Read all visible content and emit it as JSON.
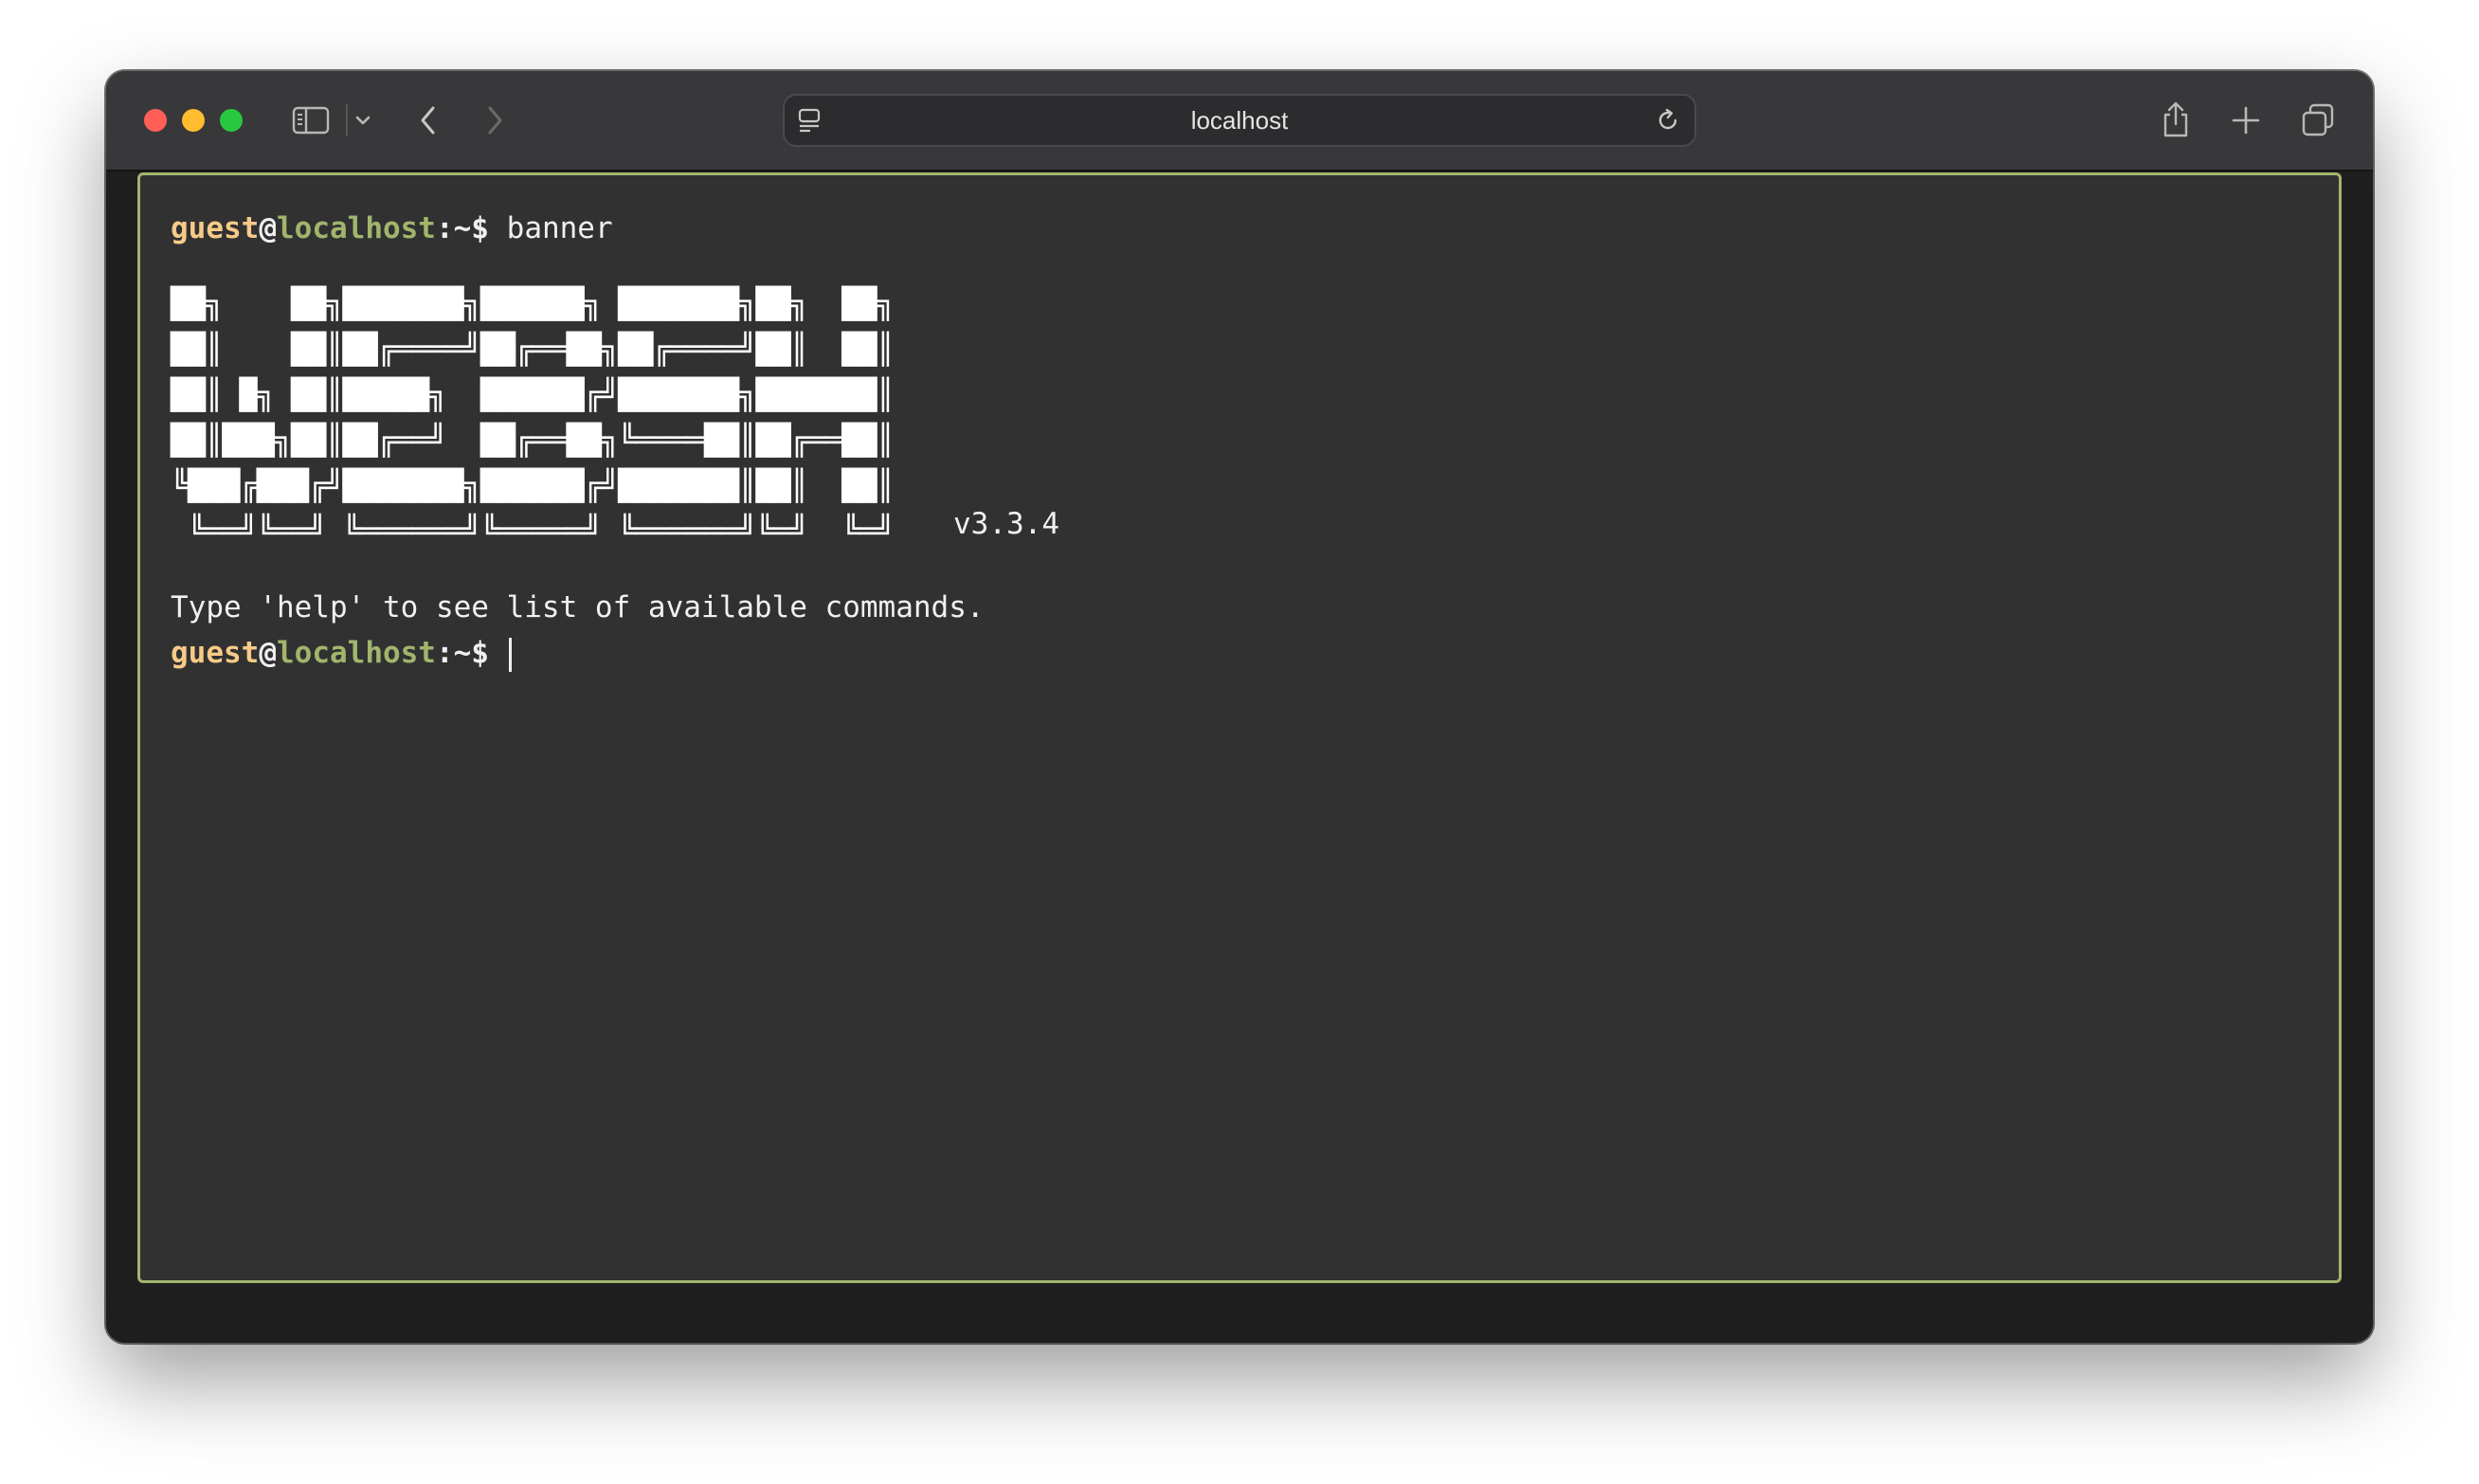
{
  "browser": {
    "address": "localhost",
    "icons": {
      "sidebar": "sidebar-icon",
      "sidebar_menu": "chevron-down-icon",
      "back": "back-icon",
      "forward": "forward-icon",
      "site_settings": "page-settings-icon",
      "reload": "reload-icon",
      "share": "share-icon",
      "new_tab": "plus-icon",
      "tabs": "tab-overview-icon"
    }
  },
  "terminal": {
    "accent_color": "#a1b56c",
    "prompt": {
      "user": "guest",
      "at": "@",
      "host": "localhost",
      "path": ":~$"
    },
    "history": [
      {
        "command": "banner"
      }
    ],
    "banner": {
      "art": "██╗    ██╗███████╗██████╗ ███████╗██╗  ██╗\n██║    ██║██╔════╝██╔══██╗██╔════╝██║  ██║\n██║ █╗ ██║█████╗  ██████╔╝███████╗███████║\n██║███╗██║██╔══╝  ██╔══██╗╚════██║██╔══██║\n╚███╔███╔╝███████╗██████╔╝███████║██║  ██║\n ╚══╝╚══╝ ╚══════╝╚═════╝ ╚══════╝╚═╝  ╚═╝",
      "version": "v3.3.4"
    },
    "help_text": "Type 'help' to see list of available commands.",
    "current_input": ""
  }
}
